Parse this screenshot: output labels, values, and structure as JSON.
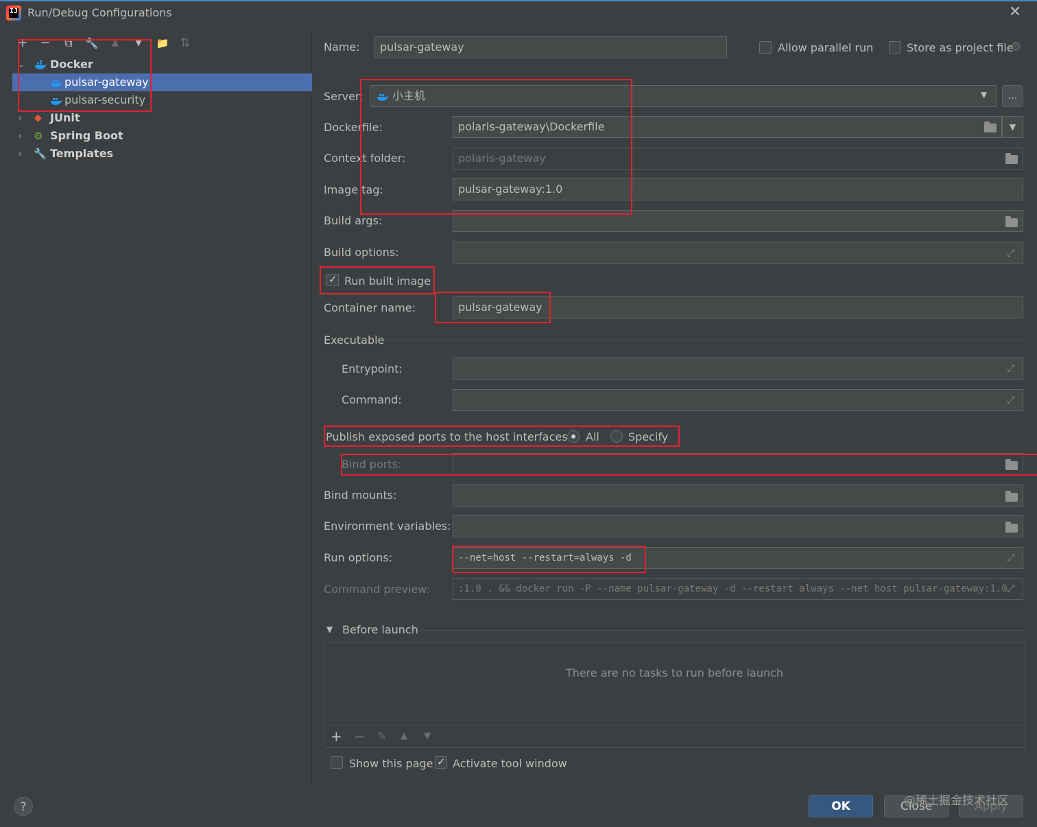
{
  "window": {
    "title": "Run/Debug Configurations",
    "logo_text": "IJ"
  },
  "toolbar": {
    "add": "+",
    "remove": "−",
    "copy": "⧉",
    "edit": "🔧",
    "up": "▲",
    "down": "▼",
    "folder": "📁",
    "sort": "⇅"
  },
  "tree": {
    "docker": "Docker",
    "items": [
      "pulsar-gateway",
      "pulsar-security"
    ],
    "junit": "JUnit",
    "spring": "Spring Boot",
    "templates": "Templates"
  },
  "header": {
    "name_label": "Name:",
    "name_value": "pulsar-gateway",
    "allow_parallel": "Allow parallel run",
    "store_project": "Store as project file"
  },
  "form": {
    "server_label": "Server:",
    "server_value": "小主机",
    "server_more": "...",
    "dockerfile_label": "Dockerfile:",
    "dockerfile_value": "polaris-gateway\\Dockerfile",
    "context_label": "Context folder:",
    "context_value": "polaris-gateway",
    "image_tag_label": "Image tag:",
    "image_tag_value": "pulsar-gateway:1.0",
    "build_args_label": "Build args:",
    "build_options_label": "Build options:",
    "run_built_image": "Run built image",
    "container_label": "Container name:",
    "container_value": "pulsar-gateway",
    "executable": "Executable",
    "entrypoint_label": "Entrypoint:",
    "command_label": "Command:",
    "publish_label": "Publish exposed ports to the host interfaces:",
    "publish_all": "All",
    "publish_specify": "Specify",
    "bind_ports_label": "Bind ports:",
    "bind_mounts_label": "Bind mounts:",
    "env_label": "Environment variables:",
    "run_options_label": "Run options:",
    "run_options_value": "--net=host --restart=always -d",
    "preview_label": "Command preview:",
    "preview_value": ":1.0 . && docker run -P --name pulsar-gateway -d --restart always --net host pulsar-gateway:1.0"
  },
  "before_launch": {
    "title": "Before launch",
    "empty": "There are no tasks to run before launch",
    "show_page": "Show this page",
    "activate": "Activate tool window"
  },
  "buttons": {
    "ok": "OK",
    "close": "Close",
    "apply": "Apply",
    "help": "?"
  },
  "watermark": "@稀土掘金技术社区",
  "colors": {
    "accent": "#4b6eaf",
    "highlight_box": "#e0232f",
    "primary_button": "#365880"
  }
}
